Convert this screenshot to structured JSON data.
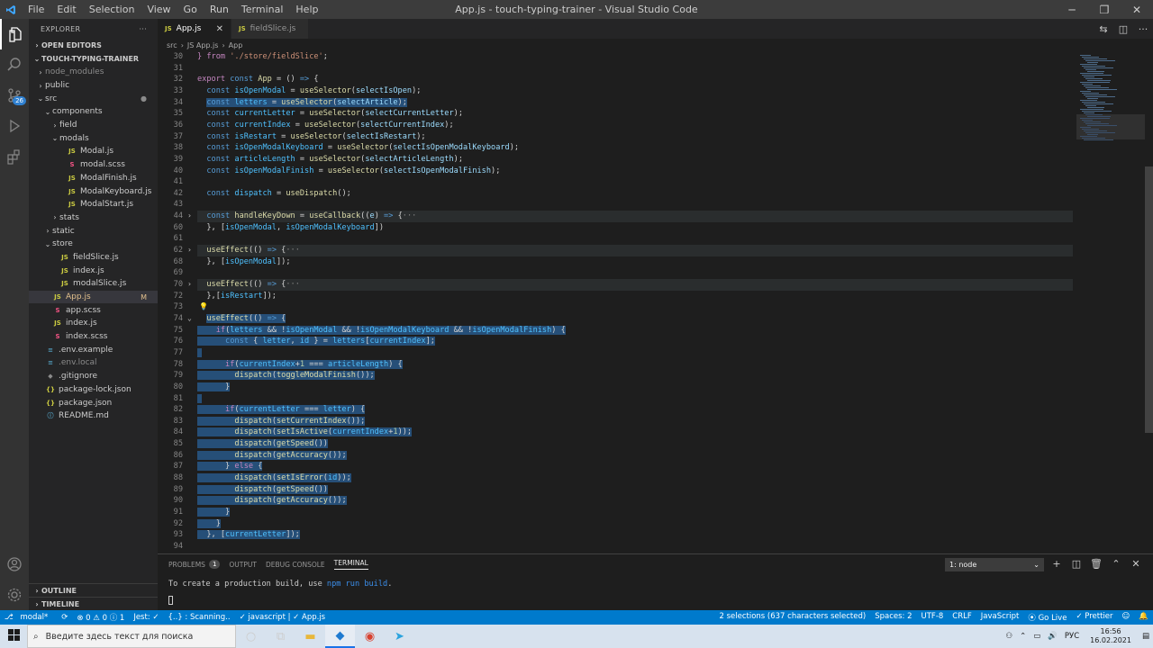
{
  "titlebar": {
    "title": "App.js - touch-typing-trainer - Visual Studio Code",
    "menu": [
      "File",
      "Edit",
      "Selection",
      "View",
      "Go",
      "Run",
      "Terminal",
      "Help"
    ]
  },
  "activity": {
    "scm_badge": "26"
  },
  "sidebar": {
    "header": "EXPLORER",
    "more": "···",
    "open_editors": "OPEN EDITORS",
    "project": "TOUCH-TYPING-TRAINER",
    "outline": "OUTLINE",
    "timeline": "TIMELINE",
    "tree": [
      {
        "label": "node_modules",
        "chev": "›",
        "icon": "",
        "indent": 1,
        "cls": "dim"
      },
      {
        "label": "public",
        "chev": "›",
        "icon": "",
        "indent": 1,
        "cls": ""
      },
      {
        "label": "src",
        "chev": "⌄",
        "icon": "",
        "indent": 1,
        "cls": "",
        "mark": "●"
      },
      {
        "label": "components",
        "chev": "⌄",
        "icon": "",
        "indent": 2,
        "cls": ""
      },
      {
        "label": "field",
        "chev": "›",
        "icon": "",
        "indent": 3,
        "cls": ""
      },
      {
        "label": "modals",
        "chev": "⌄",
        "icon": "",
        "indent": 3,
        "cls": ""
      },
      {
        "label": "Modal.js",
        "chev": "",
        "icon": "JS",
        "iconcls": "js",
        "indent": 4,
        "cls": ""
      },
      {
        "label": "modal.scss",
        "chev": "",
        "icon": "S",
        "iconcls": "scss",
        "indent": 4,
        "cls": ""
      },
      {
        "label": "ModalFinish.js",
        "chev": "",
        "icon": "JS",
        "iconcls": "js",
        "indent": 4,
        "cls": ""
      },
      {
        "label": "ModalKeyboard.js",
        "chev": "",
        "icon": "JS",
        "iconcls": "js",
        "indent": 4,
        "cls": ""
      },
      {
        "label": "ModalStart.js",
        "chev": "",
        "icon": "JS",
        "iconcls": "js",
        "indent": 4,
        "cls": ""
      },
      {
        "label": "stats",
        "chev": "›",
        "icon": "",
        "indent": 3,
        "cls": ""
      },
      {
        "label": "static",
        "chev": "›",
        "icon": "",
        "indent": 2,
        "cls": ""
      },
      {
        "label": "store",
        "chev": "⌄",
        "icon": "",
        "indent": 2,
        "cls": ""
      },
      {
        "label": "fieldSlice.js",
        "chev": "",
        "icon": "JS",
        "iconcls": "js",
        "indent": 3,
        "cls": ""
      },
      {
        "label": "index.js",
        "chev": "",
        "icon": "JS",
        "iconcls": "js",
        "indent": 3,
        "cls": ""
      },
      {
        "label": "modalSlice.js",
        "chev": "",
        "icon": "JS",
        "iconcls": "js",
        "indent": 3,
        "cls": ""
      },
      {
        "label": "App.js",
        "chev": "",
        "icon": "JS",
        "iconcls": "js",
        "indent": 2,
        "cls": "modified",
        "mark": "M",
        "selected": true
      },
      {
        "label": "app.scss",
        "chev": "",
        "icon": "S",
        "iconcls": "scss",
        "indent": 2,
        "cls": ""
      },
      {
        "label": "index.js",
        "chev": "",
        "icon": "JS",
        "iconcls": "js",
        "indent": 2,
        "cls": ""
      },
      {
        "label": "index.scss",
        "chev": "",
        "icon": "S",
        "iconcls": "scss",
        "indent": 2,
        "cls": ""
      },
      {
        "label": ".env.example",
        "chev": "",
        "icon": "≡",
        "iconcls": "info",
        "indent": 1,
        "cls": ""
      },
      {
        "label": ".env.local",
        "chev": "",
        "icon": "≡",
        "iconcls": "info",
        "indent": 1,
        "cls": "dim"
      },
      {
        "label": ".gitignore",
        "chev": "",
        "icon": "◆",
        "iconcls": "dim",
        "indent": 1,
        "cls": ""
      },
      {
        "label": "package-lock.json",
        "chev": "",
        "icon": "{}",
        "iconcls": "json",
        "indent": 1,
        "cls": ""
      },
      {
        "label": "package.json",
        "chev": "",
        "icon": "{}",
        "iconcls": "json",
        "indent": 1,
        "cls": ""
      },
      {
        "label": "README.md",
        "chev": "",
        "icon": "ⓘ",
        "iconcls": "info",
        "indent": 1,
        "cls": ""
      }
    ]
  },
  "tabs": [
    {
      "label": "App.js",
      "active": true
    },
    {
      "label": "fieldSlice.js",
      "active": false
    }
  ],
  "breadcrumb": [
    "src",
    "›",
    "JS App.js",
    "›",
    "App"
  ],
  "editor": {
    "lines": [
      {
        "n": "30",
        "html": "<span class=\"ctl\">} from</span> <span class=\"str\">'./store/fieldSlice'</span>;"
      },
      {
        "n": "31",
        "html": ""
      },
      {
        "n": "32",
        "html": "<span class=\"ctl\">export</span> <span class=\"kw\">const</span> <span class=\"fn\">App</span> = () <span class=\"kw\">=&gt;</span> {"
      },
      {
        "n": "33",
        "html": "  <span class=\"kw\">const</span> <span class=\"cst\">isOpenModal</span> = <span class=\"fn\">useSelector</span>(<span class=\"vr\">selectIsOpen</span>);"
      },
      {
        "n": "34",
        "html": "  <span class=\"sel\"><span class=\"kw\">const</span> <span class=\"cst\">letters</span> = <span class=\"fn\">useSelector</span>(<span class=\"vr\">selectArticle</span>);</span>"
      },
      {
        "n": "35",
        "html": "  <span class=\"kw\">const</span> <span class=\"cst\">currentLetter</span> = <span class=\"fn\">useSelector</span>(<span class=\"vr\">selectCurrentLetter</span>);"
      },
      {
        "n": "36",
        "html": "  <span class=\"kw\">const</span> <span class=\"cst\">currentIndex</span> = <span class=\"fn\">useSelector</span>(<span class=\"vr\">selectCurrentIndex</span>);"
      },
      {
        "n": "37",
        "html": "  <span class=\"kw\">const</span> <span class=\"cst\">isRestart</span> = <span class=\"fn\">useSelector</span>(<span class=\"vr\">selectIsRestart</span>);"
      },
      {
        "n": "38",
        "html": "  <span class=\"kw\">const</span> <span class=\"cst\">isOpenModalKeyboard</span> = <span class=\"fn\">useSelector</span>(<span class=\"vr\">selectIsOpenModalKeyboard</span>);"
      },
      {
        "n": "39",
        "html": "  <span class=\"kw\">const</span> <span class=\"cst\">articleLength</span> = <span class=\"fn\">useSelector</span>(<span class=\"vr\">selectArticleLength</span>);"
      },
      {
        "n": "40",
        "html": "  <span class=\"kw\">const</span> <span class=\"cst\">isOpenModalFinish</span> = <span class=\"fn\">useSelector</span>(<span class=\"vr\">selectIsOpenModalFinish</span>);"
      },
      {
        "n": "41",
        "html": ""
      },
      {
        "n": "42",
        "html": "  <span class=\"kw\">const</span> <span class=\"cst\">dispatch</span> = <span class=\"fn\">useDispatch</span>();"
      },
      {
        "n": "43",
        "html": ""
      },
      {
        "n": "44",
        "fold": "›",
        "cur": true,
        "html": "  <span class=\"kw\">const</span> <span class=\"fn\">handleKeyDown</span> = <span class=\"fn\">useCallback</span>((<span class=\"vr\">e</span>) <span class=\"kw\">=&gt;</span> {<span class=\"dim\">···</span>"
      },
      {
        "n": "60",
        "html": "  }, [<span class=\"cst\">isOpenModal</span>, <span class=\"cst\">isOpenModalKeyboard</span>])"
      },
      {
        "n": "61",
        "html": ""
      },
      {
        "n": "62",
        "fold": "›",
        "cur": true,
        "html": "  <span class=\"fn\">useEffect</span>(() <span class=\"kw\">=&gt;</span> {<span class=\"dim\">···</span>"
      },
      {
        "n": "68",
        "html": "  }, [<span class=\"cst\">isOpenModal</span>]);"
      },
      {
        "n": "69",
        "html": ""
      },
      {
        "n": "70",
        "fold": "›",
        "cur": true,
        "html": "  <span class=\"fn\">useEffect</span>(() <span class=\"kw\">=&gt;</span> {<span class=\"dim\">···</span>"
      },
      {
        "n": "72",
        "html": "  },[<span class=\"cst\">isRestart</span>]);"
      },
      {
        "n": "73",
        "bulb": true,
        "html": ""
      },
      {
        "n": "74",
        "fold": "⌄",
        "html": "  <span class=\"sel\"><span class=\"fn\">useEffect</span>(() <span class=\"kw\">=&gt;</span> {</span>"
      },
      {
        "n": "75",
        "html": "<span class=\"sel\">    <span class=\"ctl\">if</span>(<span class=\"cst\">letters</span> &amp;&amp; !<span class=\"cst\">isOpenModal</span> &amp;&amp; !<span class=\"cst\">isOpenModalKeyboard</span> &amp;&amp; !<span class=\"cst\">isOpenModalFinish</span>) {</span>"
      },
      {
        "n": "76",
        "html": "<span class=\"sel\">      <span class=\"kw\">const</span> { <span class=\"cst\">letter</span>, <span class=\"cst\">id</span> } = <span class=\"cst\">letters</span>[<span class=\"cst\">currentIndex</span>];</span>"
      },
      {
        "n": "77",
        "html": "<span class=\"sel\"> </span>"
      },
      {
        "n": "78",
        "html": "<span class=\"sel\">      <span class=\"ctl\">if</span>(<span class=\"cst\">currentIndex</span>+<span class=\"nm\">1</span> === <span class=\"cst\">articleLength</span>) {</span>"
      },
      {
        "n": "79",
        "html": "<span class=\"sel\">        <span class=\"fn\">dispatch</span>(<span class=\"fn\">toggleModalFinish</span>());</span>"
      },
      {
        "n": "80",
        "html": "<span class=\"sel\">      }</span>"
      },
      {
        "n": "81",
        "html": "<span class=\"sel\"> </span>"
      },
      {
        "n": "82",
        "html": "<span class=\"sel\">      <span class=\"ctl\">if</span>(<span class=\"cst\">currentLetter</span> === <span class=\"cst\">letter</span>) {</span>"
      },
      {
        "n": "83",
        "html": "<span class=\"sel\">        <span class=\"fn\">dispatch</span>(<span class=\"fn\">setCurrentIndex</span>());</span>"
      },
      {
        "n": "84",
        "html": "<span class=\"sel\">        <span class=\"fn\">dispatch</span>(<span class=\"fn\">setIsActive</span>(<span class=\"cst\">currentIndex</span>+<span class=\"nm\">1</span>));</span>"
      },
      {
        "n": "85",
        "html": "<span class=\"sel\">        <span class=\"fn\">dispatch</span>(<span class=\"fn\">getSpeed</span>())</span>"
      },
      {
        "n": "86",
        "html": "<span class=\"sel\">        <span class=\"fn\">dispatch</span>(<span class=\"fn\">getAccuracy</span>());</span>"
      },
      {
        "n": "87",
        "html": "<span class=\"sel\">      } <span class=\"ctl\">else</span> {</span>"
      },
      {
        "n": "88",
        "html": "<span class=\"sel\">        <span class=\"fn\">dispatch</span>(<span class=\"fn\">setIsError</span>(<span class=\"cst\">id</span>));</span>"
      },
      {
        "n": "89",
        "html": "<span class=\"sel\">        <span class=\"fn\">dispatch</span>(<span class=\"fn\">getSpeed</span>())</span>"
      },
      {
        "n": "90",
        "html": "<span class=\"sel\">        <span class=\"fn\">dispatch</span>(<span class=\"fn\">getAccuracy</span>());</span>"
      },
      {
        "n": "91",
        "html": "<span class=\"sel\">      }</span>"
      },
      {
        "n": "92",
        "html": "<span class=\"sel\">    }</span>"
      },
      {
        "n": "93",
        "html": "<span class=\"sel\">  }, [<span class=\"cst\">currentLetter</span>]);</span>"
      },
      {
        "n": "94",
        "html": ""
      }
    ]
  },
  "panel": {
    "tabs": [
      "PROBLEMS",
      "OUTPUT",
      "DEBUG CONSOLE",
      "TERMINAL"
    ],
    "problems_count": "1",
    "terminal_select": "1: node",
    "terminal_text_1": "To create a production build, use ",
    "terminal_cmd": "npm run build",
    "terminal_text_2": "."
  },
  "statusbar": {
    "branch": "modal*",
    "sync": "⟳",
    "errors": "⊗ 0 ⚠ 0 ⓘ 1",
    "jest": "Jest: ✓",
    "scanning": "{..} : Scanning..",
    "lang_check": "✓ javascript | ✓ App.js",
    "selections": "2 selections (637 characters selected)",
    "spaces": "Spaces: 2",
    "encoding": "UTF-8",
    "eol": "CRLF",
    "language": "JavaScript",
    "golive": "⦿ Go Live",
    "prettier": "✓ Prettier"
  },
  "taskbar": {
    "search_placeholder": "Введите здесь текст для поиска",
    "lang": "РУС",
    "time": "16:56",
    "date": "16.02.2021"
  }
}
